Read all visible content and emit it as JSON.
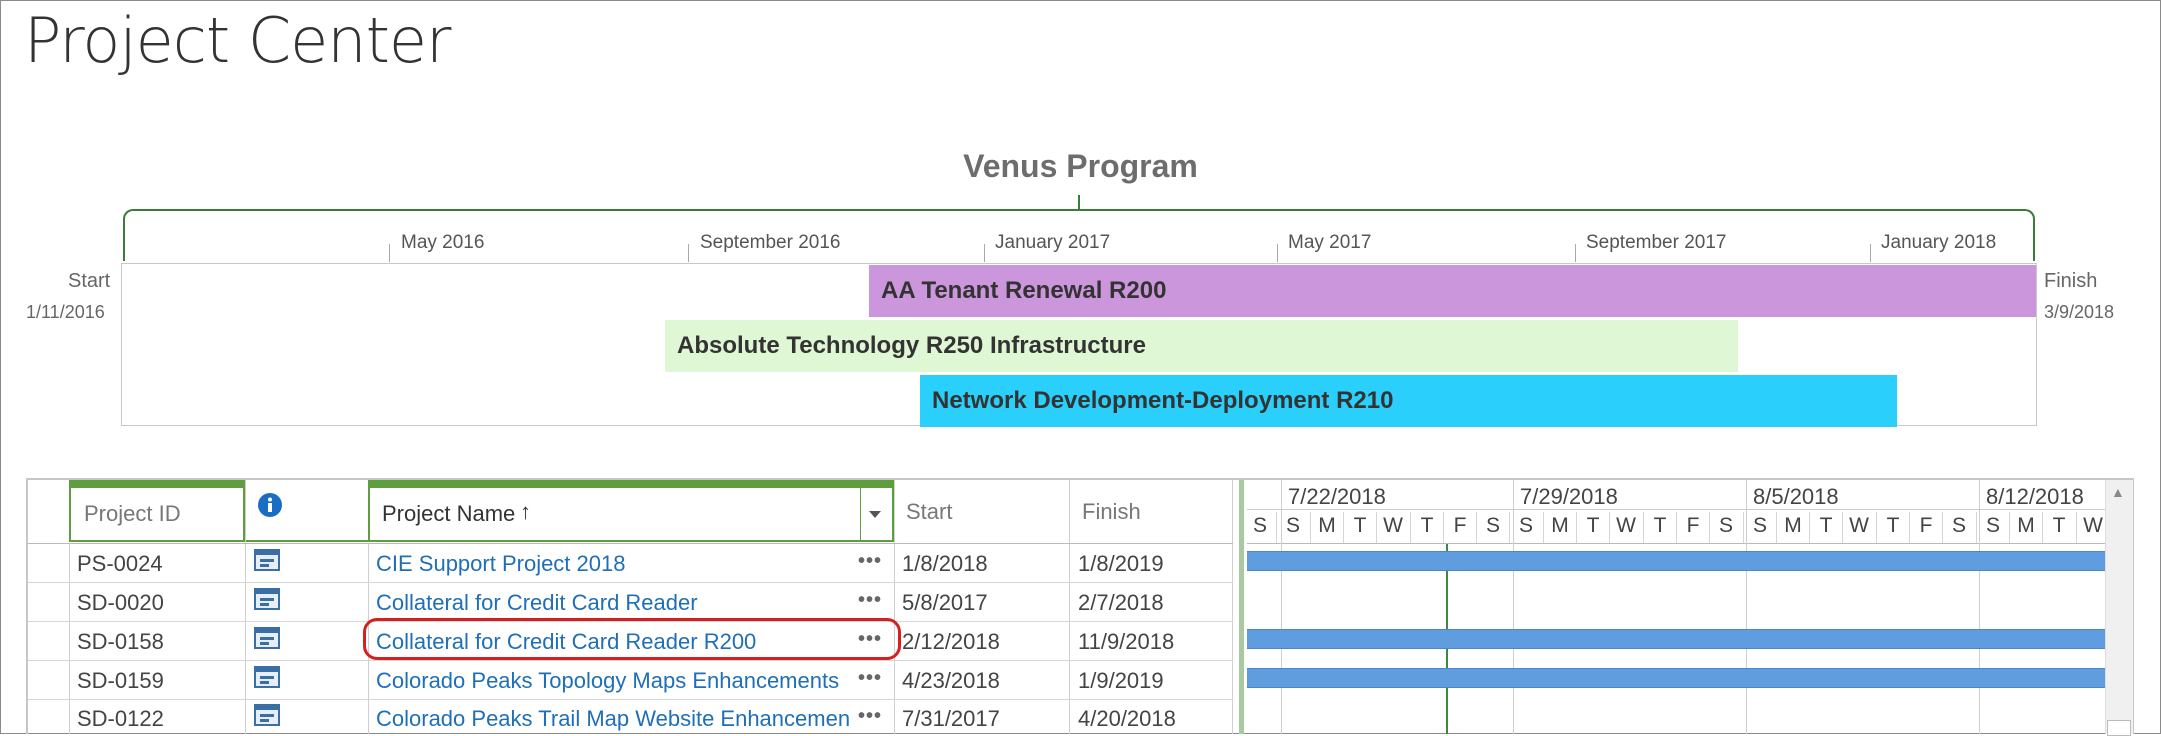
{
  "page": {
    "title": "Project Center"
  },
  "timeline": {
    "title": "Venus Program",
    "start_label": "Start",
    "start_date": "1/11/2016",
    "finish_label": "Finish",
    "finish_date": "3/9/2018",
    "months": [
      "May 2016",
      "September 2016",
      "January 2017",
      "May 2017",
      "September 2017",
      "January 2018"
    ],
    "bars": [
      {
        "label": "AA Tenant Renewal R200",
        "color": "#cc96dc"
      },
      {
        "label": "Absolute Technology R250 Infrastructure",
        "color": "#dff7d4"
      },
      {
        "label": "Network Development-Deployment R210",
        "color": "#2ad0fb"
      }
    ]
  },
  "grid": {
    "columns": {
      "project_id": "Project ID",
      "info": "info-icon",
      "project_name": "Project Name",
      "sort_indicator": "↑",
      "start": "Start",
      "finish": "Finish"
    },
    "rows": [
      {
        "id": "PS-0024",
        "name": "CIE Support Project 2018",
        "start": "1/8/2018",
        "finish": "1/8/2019",
        "ellipsis": "•••"
      },
      {
        "id": "SD-0020",
        "name": "Collateral for Credit Card Reader",
        "start": "5/8/2017",
        "finish": "2/7/2018",
        "ellipsis": "•••"
      },
      {
        "id": "SD-0158",
        "name": "Collateral for Credit Card Reader R200",
        "start": "2/12/2018",
        "finish": "11/9/2018",
        "ellipsis": "•••"
      },
      {
        "id": "SD-0159",
        "name": "Colorado Peaks Topology Maps Enhancements",
        "start": "4/23/2018",
        "finish": "1/9/2019",
        "ellipsis": "•••"
      },
      {
        "id": "SD-0122",
        "name": "Colorado Peaks Trail Map Website Enhancemen",
        "start": "7/31/2017",
        "finish": "4/20/2018",
        "ellipsis": "•••"
      }
    ],
    "highlighted_row": "SD-0158"
  },
  "gantt": {
    "weeks": [
      "7/22/2018",
      "7/29/2018",
      "8/5/2018",
      "8/12/2018"
    ],
    "days": [
      "S",
      "S",
      "M",
      "T",
      "W",
      "T",
      "F",
      "S",
      "S",
      "M",
      "T",
      "W",
      "T",
      "F",
      "S",
      "S",
      "M",
      "T",
      "W",
      "T",
      "F",
      "S",
      "S",
      "M",
      "T",
      "W"
    ],
    "bar_color": "#5f9ddf",
    "today_line_color": "#3a8a3a"
  }
}
